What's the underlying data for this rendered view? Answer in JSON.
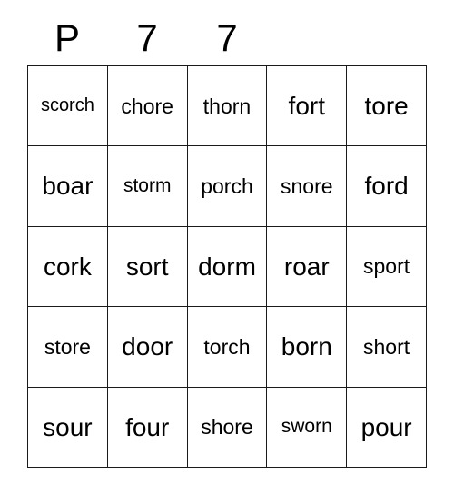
{
  "header": {
    "letters": [
      "P",
      "7",
      "7",
      "",
      ""
    ]
  },
  "grid": {
    "rows": [
      [
        "scorch",
        "chore",
        "thorn",
        "fort",
        "tore"
      ],
      [
        "boar",
        "storm",
        "porch",
        "snore",
        "ford"
      ],
      [
        "cork",
        "sort",
        "dorm",
        "roar",
        "sport"
      ],
      [
        "store",
        "door",
        "torch",
        "born",
        "short"
      ],
      [
        "sour",
        "four",
        "shore",
        "sworn",
        "pour"
      ]
    ]
  },
  "style": {
    "border_color": "#1a1a1a",
    "text_color": "#000000",
    "background": "#ffffff"
  }
}
